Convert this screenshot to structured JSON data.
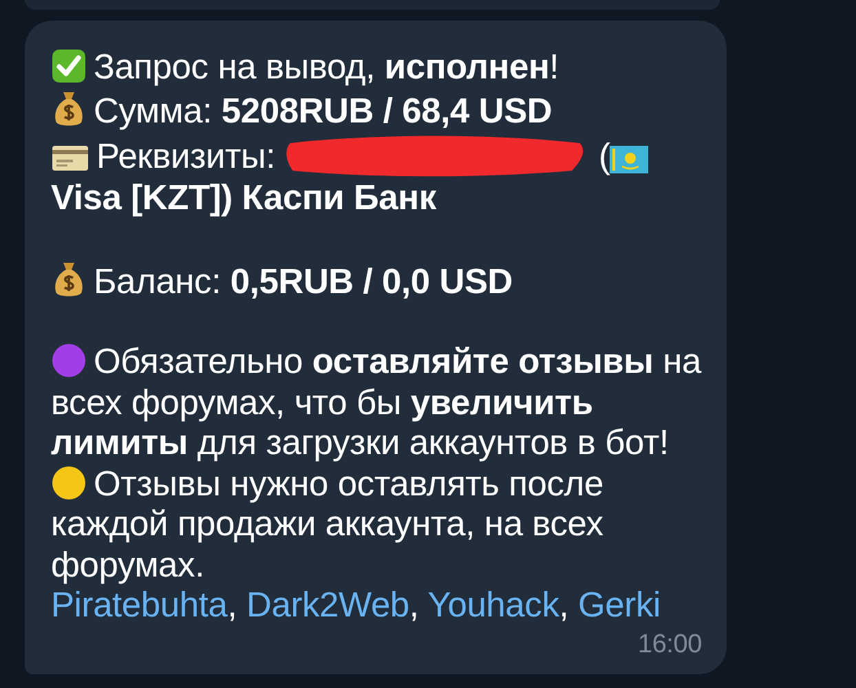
{
  "message": {
    "blocks": [
      {
        "kind": "done",
        "text": "Запрос на вывод, **исполнен**!"
      },
      {
        "kind": "amount",
        "text": "Сумма: **5208RUB / 68,4 USD**"
      },
      {
        "kind": "requisites",
        "label": "Реквизиты:",
        "redacted": true,
        "open": "(",
        "continuation": "Visa [KZT]) Каспи Банк"
      },
      {
        "kind": "balance",
        "spaced": true,
        "text": "Баланс: **0,5RUB / 0,0 USD**"
      },
      {
        "kind": "note",
        "color": "#a23ee8",
        "spaced": true,
        "text": "Обязательно **оставляйте отзывы** на всех форумах, что бы **увеличить лимиты** для загрузки аккаунтов в бот!"
      },
      {
        "kind": "note",
        "color": "#f5c518",
        "text": "Отзывы нужно оставлять после каждой продажи аккаунта, на всех форумах."
      },
      {
        "kind": "links",
        "separator": ",",
        "links": [
          "Piratebuhta",
          "Dark2Web",
          "Youhack",
          "Gerki"
        ]
      }
    ],
    "time": "16:00"
  }
}
